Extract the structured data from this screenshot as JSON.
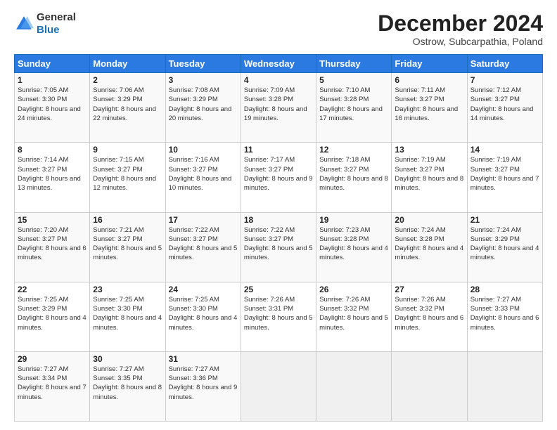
{
  "header": {
    "logo": {
      "line1": "General",
      "line2": "Blue"
    },
    "title": "December 2024",
    "subtitle": "Ostrow, Subcarpathia, Poland"
  },
  "days_of_week": [
    "Sunday",
    "Monday",
    "Tuesday",
    "Wednesday",
    "Thursday",
    "Friday",
    "Saturday"
  ],
  "weeks": [
    [
      {
        "day": "1",
        "sunrise": "7:05 AM",
        "sunset": "3:30 PM",
        "daylight": "8 hours and 24 minutes."
      },
      {
        "day": "2",
        "sunrise": "7:06 AM",
        "sunset": "3:29 PM",
        "daylight": "8 hours and 22 minutes."
      },
      {
        "day": "3",
        "sunrise": "7:08 AM",
        "sunset": "3:29 PM",
        "daylight": "8 hours and 20 minutes."
      },
      {
        "day": "4",
        "sunrise": "7:09 AM",
        "sunset": "3:28 PM",
        "daylight": "8 hours and 19 minutes."
      },
      {
        "day": "5",
        "sunrise": "7:10 AM",
        "sunset": "3:28 PM",
        "daylight": "8 hours and 17 minutes."
      },
      {
        "day": "6",
        "sunrise": "7:11 AM",
        "sunset": "3:27 PM",
        "daylight": "8 hours and 16 minutes."
      },
      {
        "day": "7",
        "sunrise": "7:12 AM",
        "sunset": "3:27 PM",
        "daylight": "8 hours and 14 minutes."
      }
    ],
    [
      {
        "day": "8",
        "sunrise": "7:14 AM",
        "sunset": "3:27 PM",
        "daylight": "8 hours and 13 minutes."
      },
      {
        "day": "9",
        "sunrise": "7:15 AM",
        "sunset": "3:27 PM",
        "daylight": "8 hours and 12 minutes."
      },
      {
        "day": "10",
        "sunrise": "7:16 AM",
        "sunset": "3:27 PM",
        "daylight": "8 hours and 10 minutes."
      },
      {
        "day": "11",
        "sunrise": "7:17 AM",
        "sunset": "3:27 PM",
        "daylight": "8 hours and 9 minutes."
      },
      {
        "day": "12",
        "sunrise": "7:18 AM",
        "sunset": "3:27 PM",
        "daylight": "8 hours and 8 minutes."
      },
      {
        "day": "13",
        "sunrise": "7:19 AM",
        "sunset": "3:27 PM",
        "daylight": "8 hours and 8 minutes."
      },
      {
        "day": "14",
        "sunrise": "7:19 AM",
        "sunset": "3:27 PM",
        "daylight": "8 hours and 7 minutes."
      }
    ],
    [
      {
        "day": "15",
        "sunrise": "7:20 AM",
        "sunset": "3:27 PM",
        "daylight": "8 hours and 6 minutes."
      },
      {
        "day": "16",
        "sunrise": "7:21 AM",
        "sunset": "3:27 PM",
        "daylight": "8 hours and 5 minutes."
      },
      {
        "day": "17",
        "sunrise": "7:22 AM",
        "sunset": "3:27 PM",
        "daylight": "8 hours and 5 minutes."
      },
      {
        "day": "18",
        "sunrise": "7:22 AM",
        "sunset": "3:27 PM",
        "daylight": "8 hours and 5 minutes."
      },
      {
        "day": "19",
        "sunrise": "7:23 AM",
        "sunset": "3:28 PM",
        "daylight": "8 hours and 4 minutes."
      },
      {
        "day": "20",
        "sunrise": "7:24 AM",
        "sunset": "3:28 PM",
        "daylight": "8 hours and 4 minutes."
      },
      {
        "day": "21",
        "sunrise": "7:24 AM",
        "sunset": "3:29 PM",
        "daylight": "8 hours and 4 minutes."
      }
    ],
    [
      {
        "day": "22",
        "sunrise": "7:25 AM",
        "sunset": "3:29 PM",
        "daylight": "8 hours and 4 minutes."
      },
      {
        "day": "23",
        "sunrise": "7:25 AM",
        "sunset": "3:30 PM",
        "daylight": "8 hours and 4 minutes."
      },
      {
        "day": "24",
        "sunrise": "7:25 AM",
        "sunset": "3:30 PM",
        "daylight": "8 hours and 4 minutes."
      },
      {
        "day": "25",
        "sunrise": "7:26 AM",
        "sunset": "3:31 PM",
        "daylight": "8 hours and 5 minutes."
      },
      {
        "day": "26",
        "sunrise": "7:26 AM",
        "sunset": "3:32 PM",
        "daylight": "8 hours and 5 minutes."
      },
      {
        "day": "27",
        "sunrise": "7:26 AM",
        "sunset": "3:32 PM",
        "daylight": "8 hours and 6 minutes."
      },
      {
        "day": "28",
        "sunrise": "7:27 AM",
        "sunset": "3:33 PM",
        "daylight": "8 hours and 6 minutes."
      }
    ],
    [
      {
        "day": "29",
        "sunrise": "7:27 AM",
        "sunset": "3:34 PM",
        "daylight": "8 hours and 7 minutes."
      },
      {
        "day": "30",
        "sunrise": "7:27 AM",
        "sunset": "3:35 PM",
        "daylight": "8 hours and 8 minutes."
      },
      {
        "day": "31",
        "sunrise": "7:27 AM",
        "sunset": "3:36 PM",
        "daylight": "8 hours and 9 minutes."
      },
      null,
      null,
      null,
      null
    ]
  ]
}
